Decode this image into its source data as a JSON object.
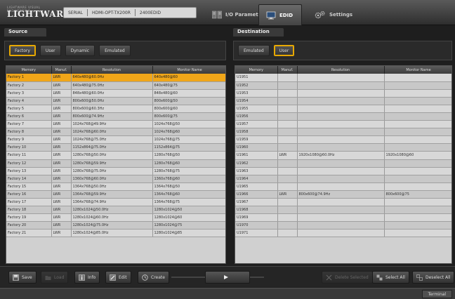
{
  "header": {
    "logo_small": "LIGHTWARE VISUAL ENGINEERING",
    "logo_main": "LIGHTWARE",
    "device": {
      "interface": "SERIAL",
      "model": "HDMI-OPT-TX200R",
      "port": "2400EDID"
    },
    "tabs": [
      {
        "label": "I/O Parameters",
        "icon": "io-parameters-icon"
      },
      {
        "label": "EDID",
        "icon": "monitor-icon"
      },
      {
        "label": "Settings",
        "icon": "gears-icon"
      }
    ]
  },
  "source": {
    "title": "Source",
    "filters": [
      "Factory",
      "User",
      "Dynamic",
      "Emulated"
    ],
    "active_filter": "Factory",
    "columns": [
      "Memory",
      "Manuf.",
      "Resolution",
      "Monitor Name"
    ],
    "rows": [
      [
        "Factory 1",
        "LWR",
        "640x480@60.0Hz",
        "640x480@60"
      ],
      [
        "Factory 2",
        "LWR",
        "640x480@75.0Hz",
        "640x480@75"
      ],
      [
        "Factory 3",
        "LWR",
        "848x480@60.0Hz",
        "848x480@60"
      ],
      [
        "Factory 4",
        "LWR",
        "800x600@50.0Hz",
        "800x600@50"
      ],
      [
        "Factory 5",
        "LWR",
        "800x600@60.3Hz",
        "800x600@60"
      ],
      [
        "Factory 6",
        "LWR",
        "800x600@74.9Hz",
        "800x600@75"
      ],
      [
        "Factory 7",
        "LWR",
        "1024x768@49.9Hz",
        "1024x768@50"
      ],
      [
        "Factory 8",
        "LWR",
        "1024x768@60.0Hz",
        "1024x768@60"
      ],
      [
        "Factory 9",
        "LWR",
        "1024x768@75.0Hz",
        "1024x768@75"
      ],
      [
        "Factory 10",
        "LWR",
        "1152x864@75.0Hz",
        "1152x864@75"
      ],
      [
        "Factory 11",
        "LWR",
        "1280x768@50.0Hz",
        "1280x768@50"
      ],
      [
        "Factory 12",
        "LWR",
        "1280x768@59.9Hz",
        "1280x768@60"
      ],
      [
        "Factory 13",
        "LWR",
        "1280x768@75.0Hz",
        "1280x768@75"
      ],
      [
        "Factory 14",
        "LWR",
        "1360x768@60.0Hz",
        "1360x768@60"
      ],
      [
        "Factory 15",
        "LWR",
        "1364x768@50.0Hz",
        "1364x768@50"
      ],
      [
        "Factory 16",
        "LWR",
        "1364x768@59.9Hz",
        "1364x768@60"
      ],
      [
        "Factory 17",
        "LWR",
        "1364x768@74.9Hz",
        "1364x768@75"
      ],
      [
        "Factory 18",
        "LWR",
        "1280x1024@50.0Hz",
        "1280x1024@50"
      ],
      [
        "Factory 19",
        "LWR",
        "1280x1024@60.0Hz",
        "1280x1024@60"
      ],
      [
        "Factory 20",
        "LWR",
        "1280x1024@75.0Hz",
        "1280x1024@75"
      ],
      [
        "Factory 21",
        "LWR",
        "1280x1024@85.0Hz",
        "1280x1024@85"
      ]
    ],
    "selected_row": 0
  },
  "destination": {
    "title": "Destination",
    "filters": [
      "Emulated",
      "User"
    ],
    "active_filter": "User",
    "columns": [
      "Memory",
      "Manuf.",
      "Resolution",
      "Monitor Name"
    ],
    "rows": [
      [
        "U1951",
        "",
        "",
        ""
      ],
      [
        "U1952",
        "",
        "",
        ""
      ],
      [
        "U1953",
        "",
        "",
        ""
      ],
      [
        "U1954",
        "",
        "",
        ""
      ],
      [
        "U1955",
        "",
        "",
        ""
      ],
      [
        "U1956",
        "",
        "",
        ""
      ],
      [
        "U1957",
        "",
        "",
        ""
      ],
      [
        "U1958",
        "",
        "",
        ""
      ],
      [
        "U1959",
        "",
        "",
        ""
      ],
      [
        "U1960",
        "",
        "",
        ""
      ],
      [
        "U1961",
        "LWR",
        "1920x1080@60.0Hz",
        "1920x1080@60"
      ],
      [
        "U1962",
        "",
        "",
        ""
      ],
      [
        "U1963",
        "",
        "",
        ""
      ],
      [
        "U1964",
        "",
        "",
        ""
      ],
      [
        "U1965",
        "",
        "",
        ""
      ],
      [
        "U1966",
        "LWR",
        "800x600@74.9Hz",
        "800x600@75"
      ],
      [
        "U1967",
        "",
        "",
        ""
      ],
      [
        "U1968",
        "",
        "",
        ""
      ],
      [
        "U1969",
        "",
        "",
        ""
      ],
      [
        "U1970",
        "",
        "",
        ""
      ],
      [
        "U1971",
        "",
        "",
        ""
      ]
    ]
  },
  "toolbar": {
    "save": "Save",
    "load": "Load",
    "info": "Info",
    "edit": "Edit",
    "create": "Create",
    "transfer": "",
    "delete": "Delete Selected",
    "select_all": "Select All",
    "deselect_all": "Deselect All"
  },
  "status": {
    "terminal": "Terminal"
  },
  "colors": {
    "accent": "#f0a619",
    "panel": "#2a2a2a"
  }
}
